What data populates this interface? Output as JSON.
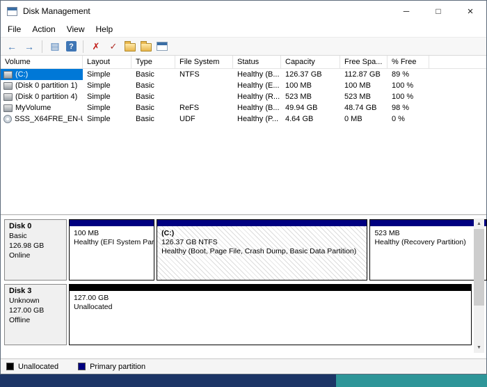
{
  "window": {
    "title": "Disk Management",
    "minimize_glyph": "─",
    "maximize_glyph": "□",
    "close_glyph": "×"
  },
  "menu": {
    "file": "File",
    "action": "Action",
    "view": "View",
    "help": "Help"
  },
  "toolbar": {
    "back_glyph": "←",
    "forward_glyph": "→",
    "console_glyph": "▤",
    "help_glyph": "?",
    "delete_glyph": "✗",
    "check_glyph": "✓"
  },
  "scrollbar": {
    "up_glyph": "▲",
    "down_glyph": "▼"
  },
  "colors": {
    "selection": "#0078d7",
    "primary_partition": "#000080",
    "unallocated": "#000000",
    "taskbar": "#1c3566",
    "accent": "#2e9598"
  },
  "volume_table": {
    "columns": [
      "Volume",
      "Layout",
      "Type",
      "File System",
      "Status",
      "Capacity",
      "Free Spa...",
      "% Free"
    ],
    "rows": [
      {
        "name": "(C:)",
        "layout": "Simple",
        "type": "Basic",
        "fs": "NTFS",
        "status": "Healthy (B...",
        "capacity": "126.37 GB",
        "free": "112.87 GB",
        "pct": "89 %"
      },
      {
        "name": "(Disk 0 partition 1)",
        "layout": "Simple",
        "type": "Basic",
        "fs": "",
        "status": "Healthy (E...",
        "capacity": "100 MB",
        "free": "100 MB",
        "pct": "100 %"
      },
      {
        "name": "(Disk 0 partition 4)",
        "layout": "Simple",
        "type": "Basic",
        "fs": "",
        "status": "Healthy (R...",
        "capacity": "523 MB",
        "free": "523 MB",
        "pct": "100 %"
      },
      {
        "name": "MyVolume",
        "layout": "Simple",
        "type": "Basic",
        "fs": "ReFS",
        "status": "Healthy (B...",
        "capacity": "49.94 GB",
        "free": "48.74 GB",
        "pct": "98 %"
      },
      {
        "name": "SSS_X64FRE_EN-U...",
        "layout": "Simple",
        "type": "Basic",
        "fs": "UDF",
        "status": "Healthy (P...",
        "capacity": "4.64 GB",
        "free": "0 MB",
        "pct": "0 %"
      }
    ]
  },
  "disks": [
    {
      "name": "Disk 0",
      "kind": "Basic",
      "size": "126.98 GB",
      "state": "Online",
      "partitions": [
        {
          "line1": "100 MB",
          "line2": "Healthy (EFI System Partition)"
        },
        {
          "title": "(C:)",
          "line1": "126.37 GB NTFS",
          "line2": "Healthy (Boot, Page File, Crash Dump, Basic Data Partition)"
        },
        {
          "line1": "523 MB",
          "line2": "Healthy (Recovery Partition)"
        }
      ]
    },
    {
      "name": "Disk 3",
      "kind": "Unknown",
      "size": "127.00 GB",
      "state": "Offline",
      "partitions": [
        {
          "line1": "127.00 GB",
          "line2": "Unallocated"
        }
      ]
    }
  ],
  "legend": [
    {
      "label": "Unallocated"
    },
    {
      "label": "Primary partition"
    }
  ]
}
